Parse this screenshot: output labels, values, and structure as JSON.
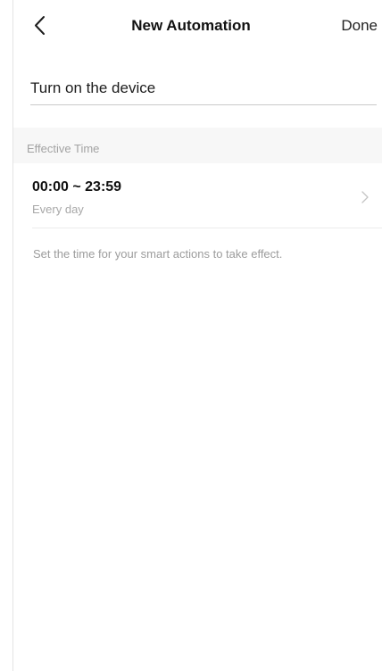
{
  "nav": {
    "title": "New Automation",
    "done_label": "Done",
    "back_icon": "chevron-left-icon"
  },
  "name_field": {
    "value": "Turn on the device",
    "placeholder": ""
  },
  "effective_time": {
    "section_label": "Effective Time",
    "time_range": "00:00 ~ 23:59",
    "repeat": "Every day",
    "chevron_icon": "chevron-right-icon",
    "hint": "Set the time for your smart actions to take effect."
  },
  "colors": {
    "text_primary": "#111111",
    "text_secondary": "#a8a8a8",
    "section_background": "#f7f7f7",
    "divider": "#ececec"
  }
}
